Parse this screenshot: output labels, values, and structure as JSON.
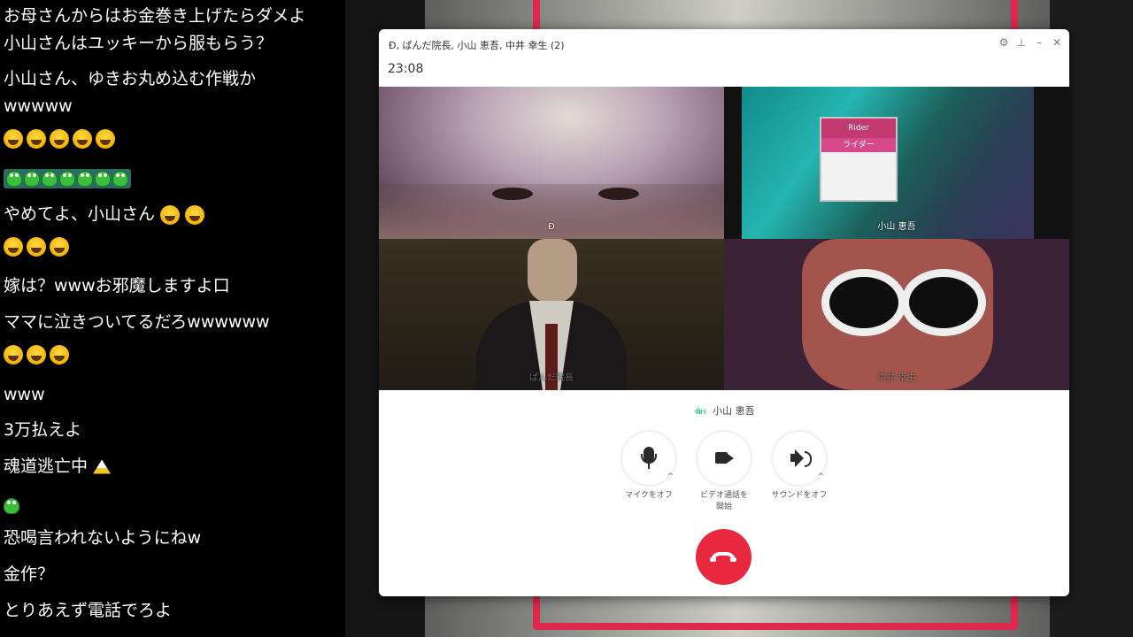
{
  "comments": [
    {
      "text": "お母さんからはお金巻き上げたらダメよ"
    },
    {
      "text": "小山さんはユッキーから服もらう？"
    },
    {
      "text": "小山さん、ゆきお丸め込む作戦か"
    },
    {
      "text": "wwwww"
    },
    {
      "text": "やめてよ、小山さん"
    },
    {
      "text": "嫁は？wwwお邪魔しますよ口"
    },
    {
      "text": "ママに泣きついてるだろwwwwww"
    },
    {
      "text": "www"
    },
    {
      "text": "3万払えよ"
    },
    {
      "text": "魂道逃亡中"
    },
    {
      "text": "恐喝言われないようにねw"
    },
    {
      "text": "金作？"
    },
    {
      "text": "とりあえず電話でろよ"
    }
  ],
  "call": {
    "title": "Ð, ぱんだ院長, 小山 恵吾, 中井 幸生  (2)",
    "timer": "23:08",
    "participants": [
      {
        "name": "Ð"
      },
      {
        "name": "小山 恵吾"
      },
      {
        "name": "ぱんだ院長"
      },
      {
        "name": "中井 幸生"
      }
    ],
    "card_text_1": "Rider",
    "card_text_2": "ライダー",
    "active_speaker": "小山 恵吾",
    "controls": {
      "mic_label": "マイクをオフ",
      "video_label_1": "ビデオ通話を",
      "video_label_2": "開始",
      "sound_label": "サウンドをオフ"
    },
    "icons": {
      "settings": "gear-icon",
      "pin": "pin-icon",
      "minimize": "minimize-icon",
      "close": "close-icon",
      "mic": "microphone-icon",
      "video": "video-camera-icon",
      "speaker": "speaker-icon",
      "hangup": "hang-up-phone-icon"
    },
    "colors": {
      "hangup": "#e8283f",
      "speaking_wave": "#00b06f",
      "stream_frame": "#e0284c"
    }
  }
}
